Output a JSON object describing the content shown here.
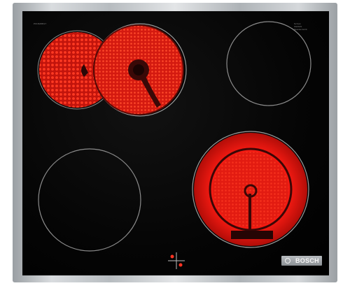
{
  "product": {
    "brand": "BOSCH",
    "model_code": "PKN645B17",
    "cleaning_label_line1": "Schott",
    "cleaning_label_line2": "CERAN",
    "cleaning_label_line3": "Glaskeramik"
  },
  "colors": {
    "glass": "#050505",
    "frame": "#c9cdd0",
    "zone_ring": "#8a8a8a",
    "heating_red": "#ff2a1a",
    "heating_dark": "#c2140c",
    "badge": "#9fa4a8"
  },
  "zones": [
    {
      "id": "rear-left-dual",
      "state": "on",
      "type": "dual-circuit",
      "circuits_active": 2
    },
    {
      "id": "rear-right",
      "state": "off",
      "type": "single"
    },
    {
      "id": "front-left",
      "state": "off",
      "type": "single"
    },
    {
      "id": "front-right-dual",
      "state": "on",
      "type": "extended-zone",
      "circuits_active": 2
    }
  ],
  "icons": {
    "zone_position_marker": "cross-dot-icon"
  }
}
